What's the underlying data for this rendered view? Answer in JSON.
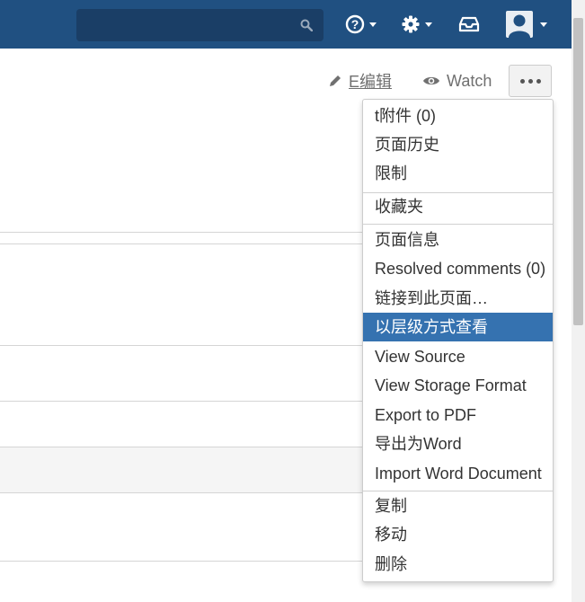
{
  "header": {
    "search": {
      "value": "",
      "placeholder": ""
    },
    "help_icon": "question-circle-icon",
    "settings_icon": "gear-icon",
    "notifications_icon": "inbox-tray-icon",
    "user_icon": "user-avatar-icon",
    "accent": "#205081"
  },
  "toolbar": {
    "edit_label": "E编辑",
    "watch_label": "Watch",
    "more_icon": "ellipsis-icon"
  },
  "menu": {
    "groups": [
      [
        "t附件 (0)",
        "页面历史",
        "限制"
      ],
      [
        "收藏夹"
      ],
      [
        "页面信息",
        "Resolved comments (0)",
        "链接到此页面…",
        "以层级方式查看",
        "View Source",
        "View Storage Format",
        "Export to PDF",
        "导出为Word",
        "Import Word Document"
      ],
      [
        "复制",
        "移动",
        "删除"
      ]
    ],
    "active_item": "以层级方式查看",
    "active_color": "#3572b0"
  }
}
